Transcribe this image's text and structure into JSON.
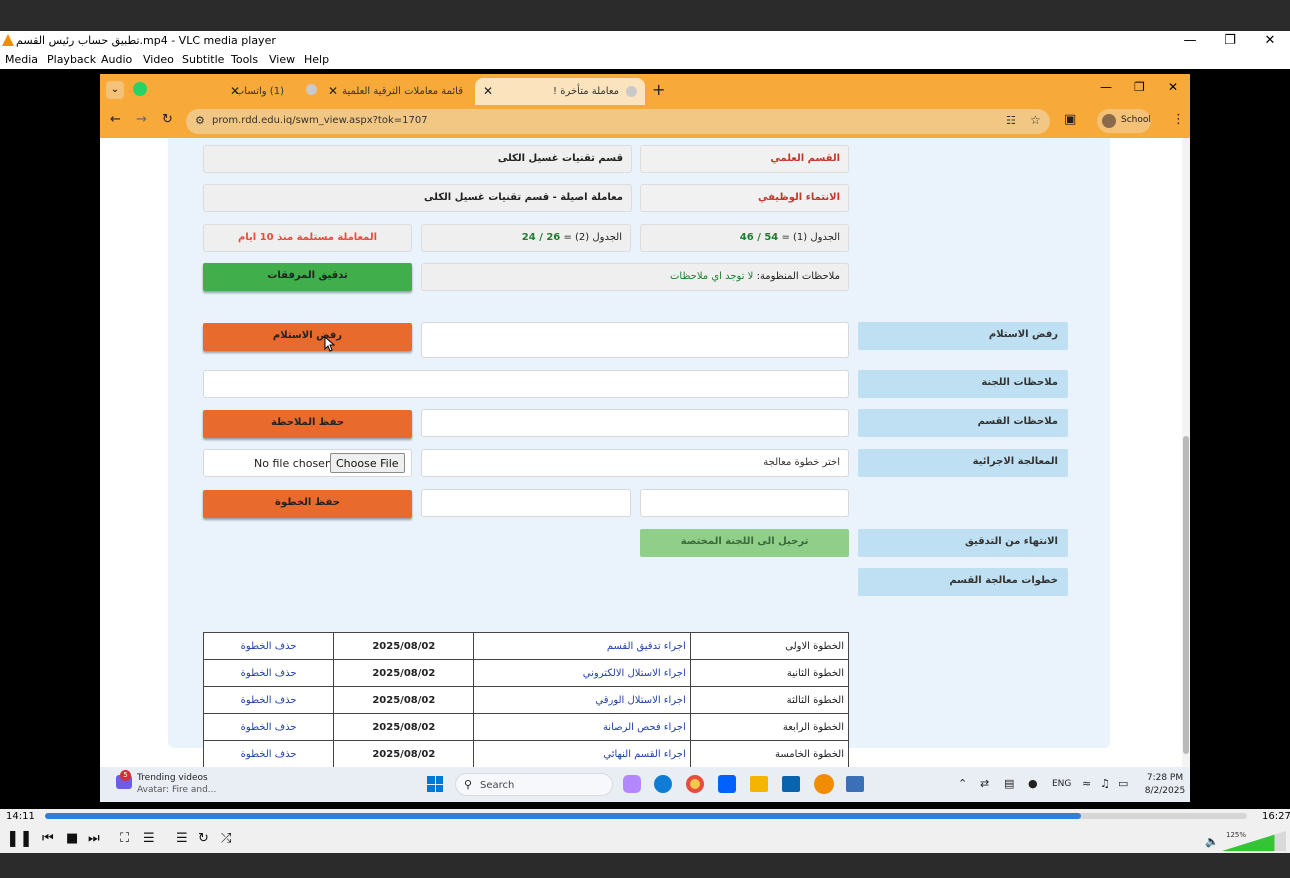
{
  "vlc": {
    "title": "تطبيق حساب رئيس القسم.mp4 - VLC media player",
    "menu": [
      "Media",
      "Playback",
      "Audio",
      "Video",
      "Subtitle",
      "Tools",
      "View",
      "Help"
    ],
    "time_elapsed": "14:11",
    "time_total": "16:27",
    "progress": 0.862,
    "volume": "125%"
  },
  "browser": {
    "tabs": [
      {
        "label": "معاملة متأخرة !",
        "active": true
      },
      {
        "label": "قائمة معاملات الترقية العلمية",
        "active": false
      },
      {
        "label": "(1) واتساب",
        "active": false
      }
    ],
    "url": "prom.rdd.edu.iq/swm_view.aspx?tok=1707",
    "profile_label": "School"
  },
  "form": {
    "dept_label": "القسم العلمي",
    "dept_value": "قسم تقنيات غسيل الكلى",
    "affiliation_label": "الانتماء الوظيفي",
    "affiliation_value": "معاملة اصيلة - قسم تقنيات غسيل الكلى",
    "table1_prefix": "الجدول (1) = ",
    "table1_value": "54 / 46",
    "table2_prefix": "الجدول (2) = ",
    "table2_value": "26 / 24",
    "received_notice": "المعاملة مستلمة منذ 10 ايام",
    "system_notes_prefix": "ملاحظات المنظومة: ",
    "system_notes_value": "لا توجد اي ملاحظات",
    "check_attachments_btn": "تدقيق المرفقات",
    "reject_label": "رفض الاستلام",
    "reject_btn": "رفض الاستلام",
    "committee_notes_label": "ملاحظات اللجنة",
    "dept_notes_label": "ملاحظات القسم",
    "save_note_btn": "حفظ الملاحظة",
    "procedure_label": "المعالجة الاجرائية",
    "procedure_placeholder": "اختر خطوة معالجة",
    "file_btn": "Choose File",
    "file_status": "No file chosen",
    "save_step_btn": "حفظ الخطوة",
    "finish_label": "الانتهاء من التدقيق",
    "forward_btn": "ترحيل الى اللجنة المختصة",
    "steps_label": "خطوات معالجة القسم"
  },
  "steps": [
    {
      "name": "الخطوة الاولى",
      "action": "اجراء تدقيق القسم",
      "date": "2025/08/02",
      "delete": "حذف الخطوة"
    },
    {
      "name": "الخطوة الثانية",
      "action": "اجراء الاستلال الالكتروني",
      "date": "2025/08/02",
      "delete": "حذف الخطوة"
    },
    {
      "name": "الخطوة الثالثة",
      "action": "اجراء الاستلال الورقي",
      "date": "2025/08/02",
      "delete": "حذف الخطوة"
    },
    {
      "name": "الخطوة الرابعة",
      "action": "اجراء فحص الرصانة",
      "date": "2025/08/02",
      "delete": "حذف الخطوة"
    },
    {
      "name": "الخطوة الخامسة",
      "action": "اجراء القسم النهائي",
      "date": "2025/08/02",
      "delete": "حذف الخطوة"
    }
  ],
  "taskbar": {
    "widget_title": "Trending videos",
    "widget_sub": "Avatar: Fire and...",
    "widget_badge": "5",
    "search": "Search",
    "lang": "ENG",
    "time": "7:28 PM",
    "date": "8/2/2025"
  },
  "colors": {
    "accent": "#f7a93a",
    "danger": "#e86a2d",
    "success": "#3fae4b",
    "label_blue": "#bfe0f3",
    "value_green": "#1e7d2f",
    "notice_red": "#e74c3c"
  }
}
